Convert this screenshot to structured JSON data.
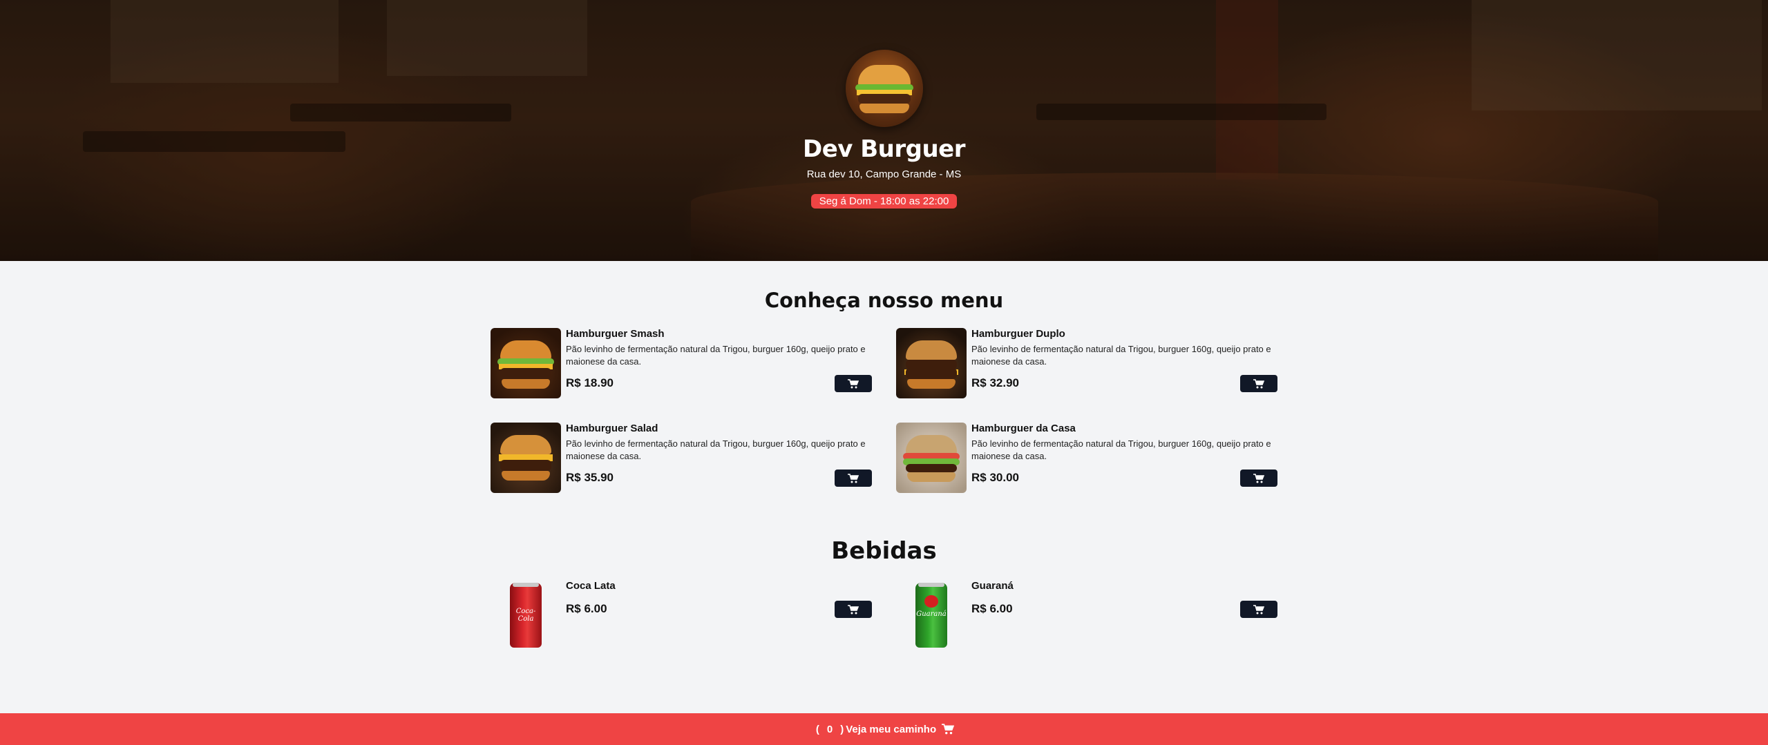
{
  "header": {
    "brand": "Dev Burguer",
    "address": "Rua dev 10, Campo Grande - MS",
    "hours": "Seg á Dom - 18:00 as 22:00"
  },
  "menu": {
    "title": "Conheça nosso menu",
    "items": [
      {
        "name": "Hamburguer Smash",
        "description": "Pão levinho de fermentação natural da Trigou, burguer 160g, queijo prato e maionese da casa.",
        "price": "R$ 18.90"
      },
      {
        "name": "Hamburguer Duplo",
        "description": "Pão levinho de fermentação natural da Trigou, burguer 160g, queijo prato e maionese da casa.",
        "price": "R$ 32.90"
      },
      {
        "name": "Hamburguer Salad",
        "description": "Pão levinho de fermentação natural da Trigou, burguer 160g, queijo prato e maionese da casa.",
        "price": "R$ 35.90"
      },
      {
        "name": "Hamburguer da Casa",
        "description": "Pão levinho de fermentação natural da Trigou, burguer 160g, queijo prato e maionese da casa.",
        "price": "R$ 30.00"
      }
    ]
  },
  "drinks": {
    "title": "Bebidas",
    "items": [
      {
        "name": "Coca Lata",
        "price": "R$ 6.00",
        "can_text": "Coca-Cola"
      },
      {
        "name": "Guaraná",
        "price": "R$ 6.00",
        "can_text": "Guaraná"
      }
    ]
  },
  "footer": {
    "open_paren": "(",
    "count": "0",
    "close_paren": ")",
    "label": "Veja meu caminho"
  },
  "icons": {
    "cart": "cart-icon"
  },
  "colors": {
    "accent": "#ef4444",
    "button": "#111827",
    "background": "#f3f4f6"
  }
}
